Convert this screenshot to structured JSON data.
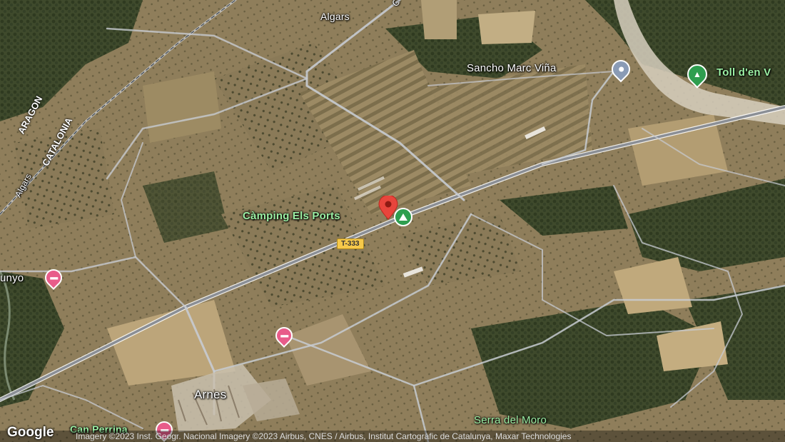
{
  "places": {
    "algars_village": "Algars",
    "sancho": "Sancho Marc Viña",
    "toll": "Toll d'en V",
    "camping": "Càmping Els Ports",
    "unyo": "unyo",
    "arnes": "Arnes",
    "serra": "Serra del Moro",
    "can_perrina": "Can Perrina"
  },
  "roads": {
    "t333": "T-333",
    "algars_river": "Algars",
    "c_road": "C"
  },
  "border": {
    "aragon": "ARAGON",
    "catalonia": "CATALONIA"
  },
  "attribution": "Imagery ©2023 Inst. Geogr. Nacional Imagery ©2023 Airbus, CNES / Airbus, Institut Cartogràfic de Catalunya, Maxar Technologies",
  "logo": "Google",
  "colors": {
    "camping_pin": "#e8453c",
    "camping_badge": "#2e9e4f",
    "hotel_pin": "#e85c8a",
    "poi_pin": "#8a9bb5",
    "park_icon": "#2e9e4f"
  },
  "icons": [
    "location-pin-icon",
    "tent-icon",
    "bed-icon",
    "hiker-icon",
    "place-icon"
  ]
}
